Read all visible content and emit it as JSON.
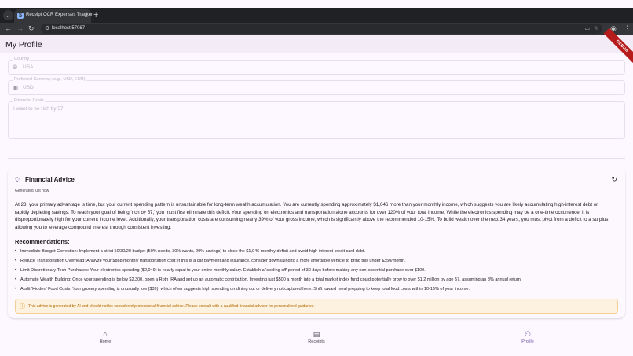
{
  "browser": {
    "tab_title": "Receipt OCR Expenses Tracker",
    "tab_favicon": "S",
    "url": "localhost:57067"
  },
  "appbar": {
    "title": "My Profile",
    "debug_banner": "DEBUG"
  },
  "fields": {
    "country": {
      "label": "Country",
      "value": "USA",
      "icon": "globe-icon"
    },
    "currency": {
      "label": "Preferred Currency (e.g., USD, EUR)",
      "value": "USD",
      "icon": "currency-icon"
    },
    "goals": {
      "label": "Financial Goals",
      "value": "I want to be rich by 57"
    }
  },
  "advice": {
    "title": "Financial Advice",
    "generated": "Generated just now",
    "body": "At 23, your primary advantage is time, but your current spending pattern is unsustainable for long-term wealth accumulation. You are currently spending approximately $1,046 more than your monthly income, which suggests you are likely accumulating high-interest debt or rapidly depleting savings. To reach your goal of being 'rich by 57,' you must first eliminate this deficit. Your spending on electronics and transportation alone accounts for over 120% of your total income. While the electronics spending may be a one-time occurrence, it is disproportionately high for your current income level. Additionally, your transportation costs are consuming nearly 39% of your gross income, which is significantly above the recommended 10-15%. To build wealth over the next 34 years, you must pivot from a deficit to a surplus, allowing you to leverage compound interest through consistent investing.",
    "recommendations_title": "Recommendations:",
    "recommendations": [
      "Immediate Budget Correction: Implement a strict 50/30/20 budget (50% needs, 30% wants, 20% savings) to close the $1,046 monthly deficit and avoid high-interest credit card debt.",
      "Reduce Transportation Overhead: Analyze your $888 monthly transportation cost; if this is a car payment and insurance, consider downsizing to a more affordable vehicle to bring this under $350/month.",
      "Limit Discretionary Tech Purchases: Your electronics spending ($2,049) is nearly equal to your entire monthly salary. Establish a 'cooling off' period of 30 days before making any non-essential purchase over $100.",
      "Automate Wealth Building: Once your spending is below $2,300, open a Roth IRA and set up an automatic contribution. Investing just $500 a month into a total market index fund could potentially grow to over $1.2 million by age 57, assuming an 8% annual return.",
      "Audit 'Hidden' Food Costs: Your grocery spending is unusually low ($39), which often suggests high spending on dining out or delivery not captured here. Shift toward meal prepping to keep total food costs within 10-15% of your income."
    ],
    "disclaimer": "This advice is generated by AI and should not be considered professional financial advice. Please consult with a qualified financial advisor for personalized guidance."
  },
  "bottom_nav": [
    {
      "label": "Home",
      "icon": "home-icon",
      "active": false
    },
    {
      "label": "Receipts",
      "icon": "receipt-icon",
      "active": false
    },
    {
      "label": "Profile",
      "icon": "person-icon",
      "active": true
    }
  ],
  "colors": {
    "primary": "#6750a4",
    "appbar_bg": "#f3ecf6",
    "warning_bg": "#fdf1df",
    "warning_text": "#b06a00"
  }
}
